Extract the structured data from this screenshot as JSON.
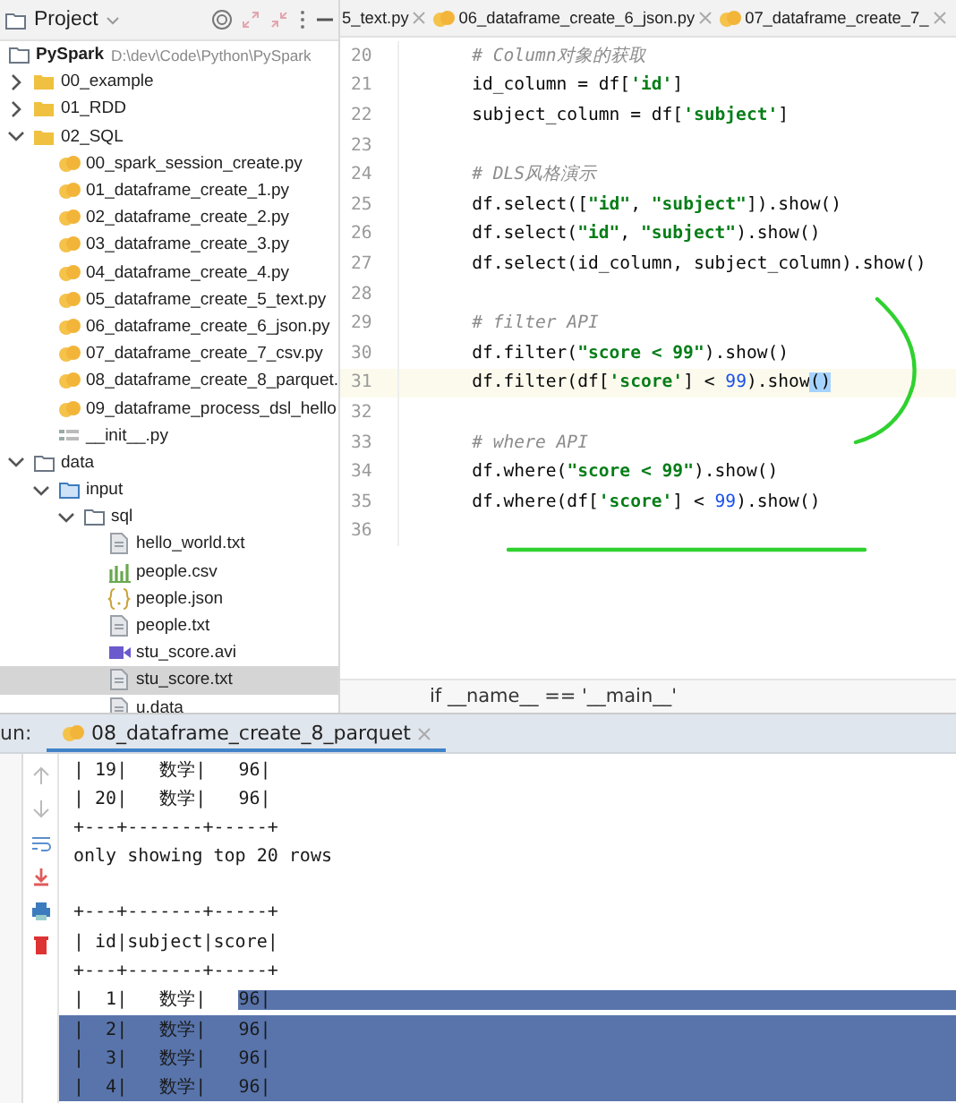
{
  "project_panel": {
    "title": "Project",
    "tree": [
      {
        "name": "PySpark",
        "path": "D:\\dev\\Code\\Python\\PySpark",
        "kind": "project",
        "selected": false,
        "children": [
          {
            "name": "00_example",
            "kind": "folder",
            "expanded": false,
            "selected": false
          },
          {
            "name": "01_RDD",
            "kind": "folder",
            "expanded": false,
            "selected": false
          },
          {
            "name": "02_SQL",
            "kind": "folder",
            "expanded": true,
            "selected": false,
            "children": [
              {
                "name": "00_spark_session_create.py",
                "kind": "python",
                "selected": false
              },
              {
                "name": "01_dataframe_create_1.py",
                "kind": "python",
                "selected": false
              },
              {
                "name": "02_dataframe_create_2.py",
                "kind": "python",
                "selected": false
              },
              {
                "name": "03_dataframe_create_3.py",
                "kind": "python",
                "selected": false
              },
              {
                "name": "04_dataframe_create_4.py",
                "kind": "python",
                "selected": false
              },
              {
                "name": "05_dataframe_create_5_text.py",
                "kind": "python",
                "selected": false
              },
              {
                "name": "06_dataframe_create_6_json.py",
                "kind": "python",
                "selected": false
              },
              {
                "name": "07_dataframe_create_7_csv.py",
                "kind": "python",
                "selected": false
              },
              {
                "name": "08_dataframe_create_8_parquet.",
                "kind": "python",
                "selected": false
              },
              {
                "name": "09_dataframe_process_dsl_hello",
                "kind": "python",
                "selected": false
              },
              {
                "name": "__init__.py",
                "kind": "init",
                "selected": false
              }
            ]
          },
          {
            "name": "data",
            "kind": "dir",
            "expanded": true,
            "selected": false,
            "children": [
              {
                "name": "input",
                "kind": "source",
                "expanded": true,
                "selected": false,
                "children": [
                  {
                    "name": "sql",
                    "kind": "dir",
                    "expanded": true,
                    "selected": false,
                    "children": [
                      {
                        "name": "hello_world.txt",
                        "kind": "text",
                        "selected": false
                      },
                      {
                        "name": "people.csv",
                        "kind": "csv",
                        "selected": false
                      },
                      {
                        "name": "people.json",
                        "kind": "json",
                        "selected": false
                      },
                      {
                        "name": "people.txt",
                        "kind": "text",
                        "selected": false
                      },
                      {
                        "name": "stu_score.avi",
                        "kind": "video",
                        "selected": false
                      },
                      {
                        "name": "stu_score.txt",
                        "kind": "text",
                        "selected": true
                      },
                      {
                        "name": "u.data",
                        "kind": "text",
                        "selected": false
                      }
                    ]
                  }
                ]
              }
            ]
          }
        ]
      }
    ]
  },
  "editor": {
    "tabs": [
      {
        "label": "5_text.py",
        "icon": false,
        "selected": false
      },
      {
        "label": "06_dataframe_create_6_json.py",
        "icon": true,
        "selected": false
      },
      {
        "label": "07_dataframe_create_7_",
        "icon": true,
        "selected": false
      }
    ],
    "lines": [
      {
        "number": "20",
        "current": false,
        "tokens": [
          {
            "kind": "comment",
            "text": "    # Column对象的获取"
          }
        ]
      },
      {
        "number": "21",
        "current": false,
        "tokens": [
          {
            "kind": "plain",
            "text": "    id_column = df["
          },
          {
            "kind": "string",
            "text": "'id'"
          },
          {
            "kind": "plain",
            "text": "]"
          }
        ]
      },
      {
        "number": "22",
        "current": false,
        "tokens": [
          {
            "kind": "plain",
            "text": "    subject_column = df["
          },
          {
            "kind": "string",
            "text": "'subject'"
          },
          {
            "kind": "plain",
            "text": "]"
          }
        ]
      },
      {
        "number": "23",
        "current": false
      },
      {
        "number": "24",
        "current": false,
        "tokens": [
          {
            "kind": "comment",
            "text": "    # DLS风格演示"
          }
        ]
      },
      {
        "number": "25",
        "current": false,
        "tokens": [
          {
            "kind": "plain",
            "text": "    df.select(["
          },
          {
            "kind": "string",
            "text": "\"id\""
          },
          {
            "kind": "plain",
            "text": ", "
          },
          {
            "kind": "string",
            "text": "\"subject\""
          },
          {
            "kind": "plain",
            "text": "]).show()"
          }
        ]
      },
      {
        "number": "26",
        "current": false,
        "tokens": [
          {
            "kind": "plain",
            "text": "    df.select("
          },
          {
            "kind": "string",
            "text": "\"id\""
          },
          {
            "kind": "plain",
            "text": ", "
          },
          {
            "kind": "string",
            "text": "\"subject\""
          },
          {
            "kind": "plain",
            "text": ").show()"
          }
        ]
      },
      {
        "number": "27",
        "current": false,
        "tokens": [
          {
            "kind": "plain",
            "text": "    df.select(id_column, subject_column).show()"
          }
        ]
      },
      {
        "number": "28",
        "current": false
      },
      {
        "number": "29",
        "current": false,
        "tokens": [
          {
            "kind": "comment",
            "text": "    # filter API"
          }
        ]
      },
      {
        "number": "30",
        "current": false,
        "tokens": [
          {
            "kind": "plain",
            "text": "    df.filter("
          },
          {
            "kind": "string",
            "text": "\"score < 99\""
          },
          {
            "kind": "plain",
            "text": ").show()"
          }
        ]
      },
      {
        "number": "31",
        "current": true,
        "tokens": [
          {
            "kind": "plain",
            "text": "    df.filter(df["
          },
          {
            "kind": "string",
            "text": "'score'"
          },
          {
            "kind": "plain",
            "text": "] < "
          },
          {
            "kind": "number",
            "text": "99"
          },
          {
            "kind": "plain",
            "text": ").show"
          },
          {
            "kind": "selection",
            "text": "()"
          }
        ]
      },
      {
        "number": "32",
        "current": false
      },
      {
        "number": "33",
        "current": false,
        "tokens": [
          {
            "kind": "comment",
            "text": "    # where API"
          }
        ]
      },
      {
        "number": "34",
        "current": false,
        "tokens": [
          {
            "kind": "plain",
            "text": "    df.where("
          },
          {
            "kind": "string",
            "text": "\"score < 99\""
          },
          {
            "kind": "plain",
            "text": ").show()"
          }
        ]
      },
      {
        "number": "35",
        "current": false,
        "tokens": [
          {
            "kind": "plain",
            "text": "    df.where(df["
          },
          {
            "kind": "string",
            "text": "'score'"
          },
          {
            "kind": "plain",
            "text": "] < "
          },
          {
            "kind": "number",
            "text": "99"
          },
          {
            "kind": "plain",
            "text": ").show()"
          }
        ]
      },
      {
        "number": "36",
        "current": false
      }
    ],
    "breadcrumb": "if __name__ == '__main__'"
  },
  "run_panel": {
    "label": "un:",
    "tabs": [
      {
        "label": "08_dataframe_create_8_parquet",
        "selected": true
      }
    ],
    "blocks": [
      [
        [
          {
            "text": "| 19|   数学|   96|",
            "selected": false
          }
        ],
        [
          {
            "text": "| 20|   数学|   96|",
            "selected": false
          }
        ],
        [
          {
            "text": "+---+-------+-----+",
            "selected": false
          }
        ],
        [
          {
            "text": "only showing top 20 rows",
            "selected": false
          }
        ]
      ],
      [
        [
          {
            "text": "+---+-------+-----+",
            "selected": false
          }
        ],
        [
          {
            "text": "| id|subject|score|",
            "selected": false
          }
        ],
        [
          {
            "text": "+---+-------+-----+",
            "selected": false
          }
        ],
        [
          {
            "text": "|  1|   数学|   ",
            "selected": false
          },
          {
            "text": "96|",
            "selected": true
          }
        ],
        [
          {
            "text": "|  2|   数学|   96|",
            "selected": true
          }
        ],
        [
          {
            "text": "|  3|   数学|   96|",
            "selected": true
          }
        ],
        [
          {
            "text": "|  4|   数学|   96|",
            "selected": true
          }
        ]
      ]
    ]
  }
}
